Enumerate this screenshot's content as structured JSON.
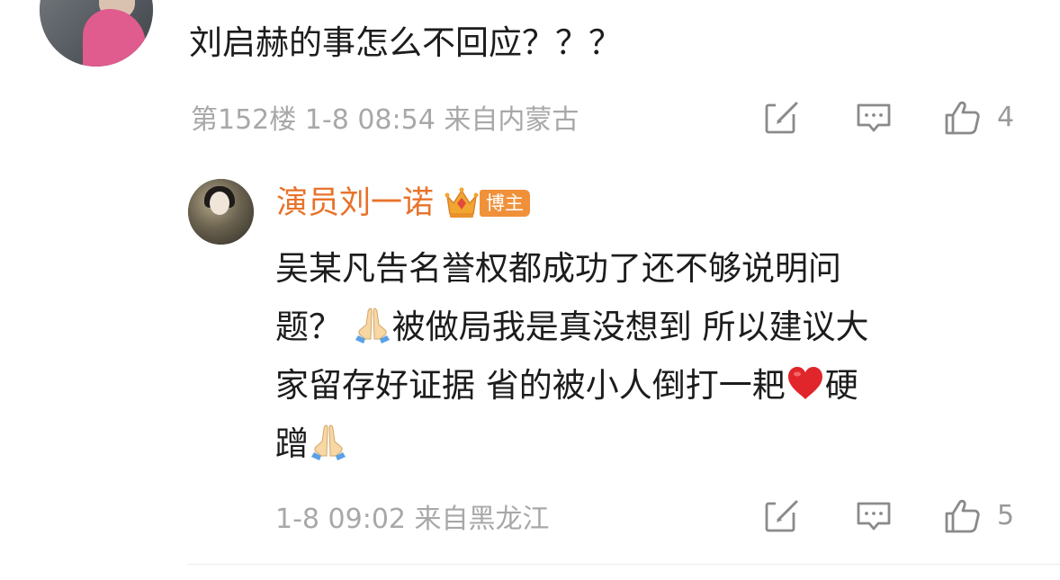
{
  "comment": {
    "text": "刘启赫的事怎么不回应？？？",
    "floor_meta": "第152楼 1-8 08:54 来自内蒙古",
    "like_count": "4",
    "icons": [
      "edit-icon",
      "comment-icon",
      "like-icon"
    ]
  },
  "reply": {
    "author": "演员刘一诺",
    "badge": "博主",
    "text": {
      "line1": "吴某凡告名誉权都成功了还不够说明问",
      "line2_pre": "题？ ",
      "line2_post": "被做局我是真没想到 所以建议大",
      "line3_pre": "家留存好证据 省的被小人倒打一耙",
      "line3_post": "硬",
      "line4": "蹭"
    },
    "emojis": [
      "praying-hands",
      "red-heart",
      "praying-hands"
    ],
    "meta": "1-8 09:02 来自黑龙江",
    "like_count": "5",
    "icons": [
      "edit-icon",
      "comment-icon",
      "like-icon"
    ]
  },
  "colors": {
    "author_name": "#e8732b",
    "badge_bg": "#f0913a",
    "meta_text": "#a8a8a8",
    "icon_stroke": "#8a8a8a",
    "heart": "#e0262b"
  }
}
